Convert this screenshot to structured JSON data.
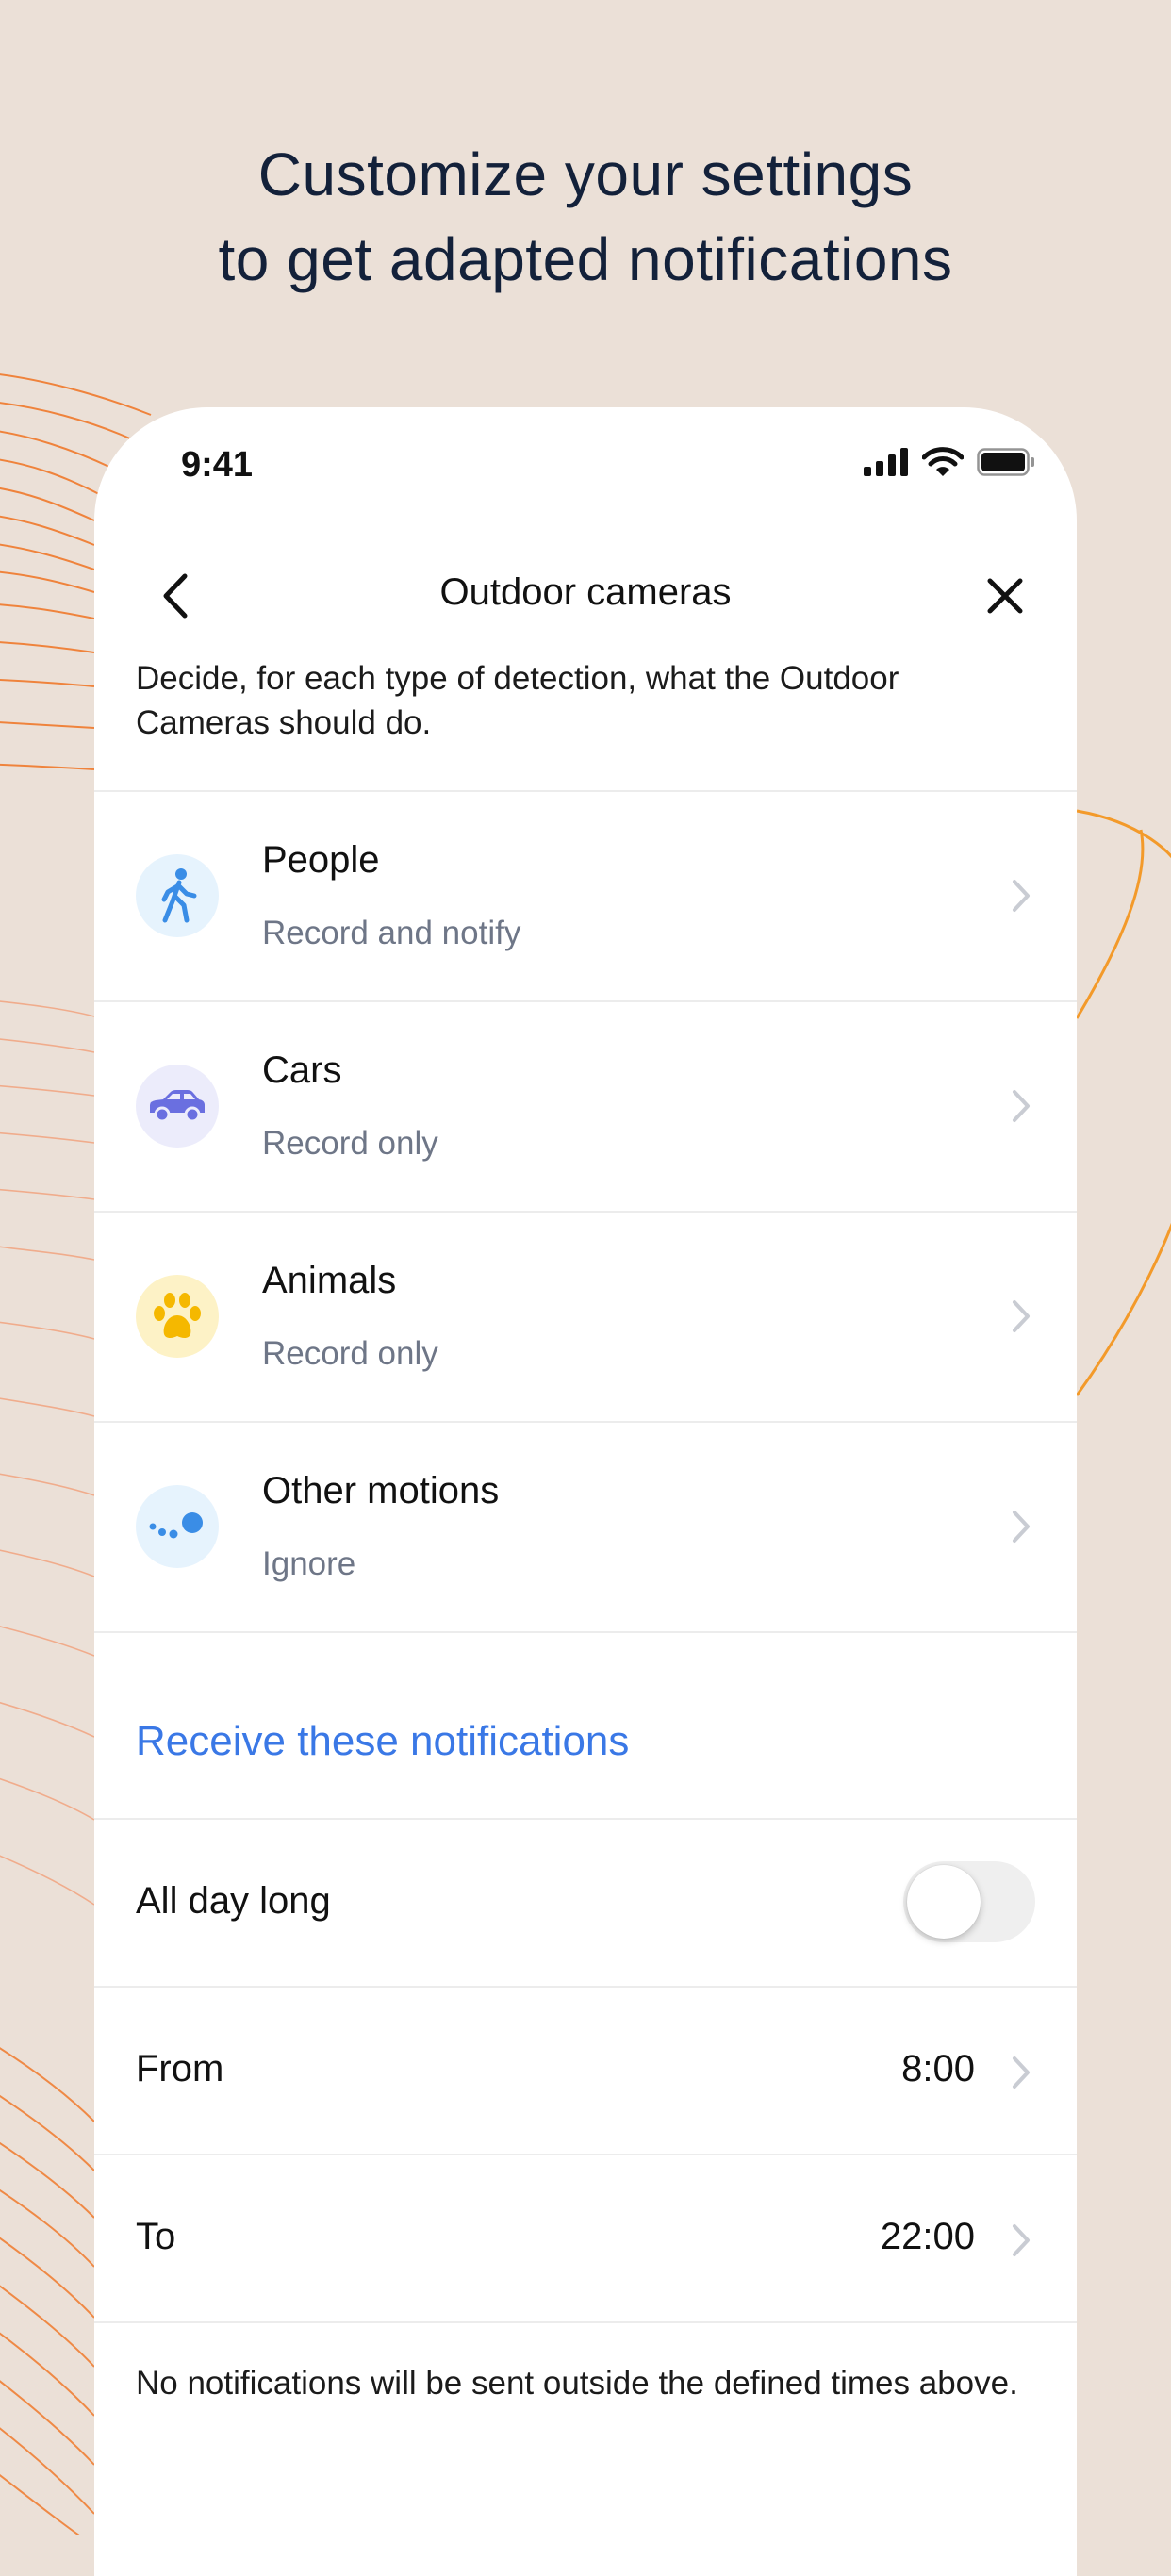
{
  "headline": {
    "line1": "Customize your settings",
    "line2": "to get adapted notifications"
  },
  "status_bar": {
    "time": "9:41",
    "icons": [
      "cellular-signal-icon",
      "wifi-icon",
      "battery-icon"
    ]
  },
  "nav": {
    "title": "Outdoor cameras",
    "back_icon": "chevron-left-icon",
    "close_icon": "close-icon"
  },
  "intro": "Decide, for each type of detection, what the Outdoor Cameras should do.",
  "detections": [
    {
      "title": "People",
      "subtitle": "Record and notify",
      "icon": "walking-person-icon",
      "icon_color": "#3a8de6",
      "icon_bg": "#e6f3fd"
    },
    {
      "title": "Cars",
      "subtitle": "Record only",
      "icon": "car-icon",
      "icon_color": "#6a6fe0",
      "icon_bg": "#ececfb"
    },
    {
      "title": "Animals",
      "subtitle": "Record only",
      "icon": "paw-icon",
      "icon_color": "#f5b800",
      "icon_bg": "#fdf2c6"
    },
    {
      "title": "Other motions",
      "subtitle": "Ignore",
      "icon": "motion-dots-icon",
      "icon_color": "#3a8de6",
      "icon_bg": "#e6f3fd"
    }
  ],
  "notifications": {
    "section_title": "Receive these notifications",
    "all_day": {
      "label": "All day long",
      "enabled": false
    },
    "from": {
      "label": "From",
      "value": "8:00"
    },
    "to": {
      "label": "To",
      "value": "22:00"
    },
    "footnote": "No notifications will be sent outside the defined times above."
  },
  "colors": {
    "background": "#ebe0d7",
    "accent": "#3a78e6",
    "headline": "#13213a",
    "decor_lines": "#f07a2c"
  }
}
